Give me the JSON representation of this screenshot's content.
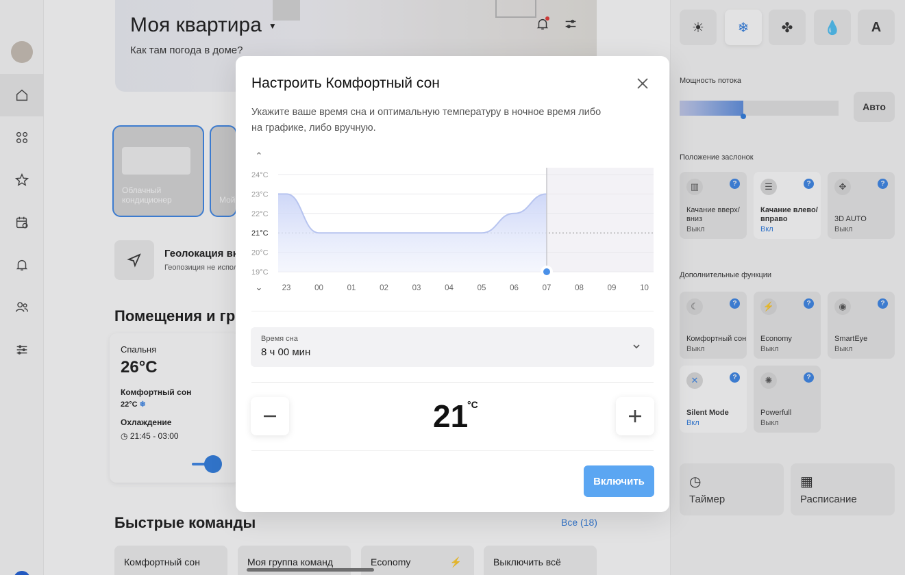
{
  "header": {
    "title": "Моя квартира",
    "subtitle": "Как там погода в доме?"
  },
  "devices": [
    {
      "label": "Облачный кондиционер"
    },
    {
      "label": "Мой"
    }
  ],
  "geo": {
    "title": "Геолокация вк",
    "subtitle": "Геопозиция не испол"
  },
  "rooms_title": "Помещения и гр",
  "room": {
    "name": "Спальня",
    "temp": "26°C",
    "mode_label": "Комфортный сон",
    "mode_temp": "22°C",
    "cooling": "Охлаждение",
    "schedule": "21:45 - 03:00"
  },
  "quick": {
    "title": "Быстрые команды",
    "all": "Все (18)",
    "items": [
      "Комфортный сон",
      "Моя группа команд",
      "Economy",
      "Выключить всё"
    ]
  },
  "right_panel": {
    "modes": [
      "sun-icon",
      "snowflake-icon",
      "fan-icon",
      "drop-icon",
      "A"
    ],
    "flow_label": "Мощность потока",
    "flow_auto": "Авто",
    "flow_level": 0.4,
    "louver_label": "Положение заслонок",
    "louvers": [
      {
        "name": "Качание вверх/вниз",
        "state": "Выкл",
        "on": false
      },
      {
        "name": "Качание влево/вправо",
        "state": "Вкл",
        "on": true
      },
      {
        "name": "3D AUTO",
        "state": "Выкл",
        "on": false
      }
    ],
    "extra_label": "Дополнительные функции",
    "features": [
      {
        "name": "Комфортный сон",
        "state": "Выкл"
      },
      {
        "name": "Economy",
        "state": "Выкл"
      },
      {
        "name": "SmartEye",
        "state": "Выкл"
      },
      {
        "name": "Silent Mode",
        "state": "Вкл"
      },
      {
        "name": "Powerfull",
        "state": "Выкл"
      }
    ],
    "timer": "Таймер",
    "schedule": "Расписание"
  },
  "modal": {
    "title": "Настроить Комфортный сон",
    "description": "Укажите ваше время сна и оптимальную температуру в ночное время либо на графике, либо вручную.",
    "sleep_label": "Время сна",
    "sleep_value": "8 ч 00 мин",
    "temperature": "21",
    "unit": "°C",
    "enable": "Включить"
  },
  "chart_data": {
    "type": "area",
    "x": [
      "23",
      "00",
      "01",
      "02",
      "03",
      "04",
      "05",
      "06",
      "07",
      "08",
      "09",
      "10"
    ],
    "y_ticks": [
      "24°C",
      "23°C",
      "22°C",
      "21°C",
      "20°C",
      "19°C"
    ],
    "ylim": [
      19,
      24
    ],
    "series": [
      {
        "values": [
          23,
          21,
          21,
          21,
          21,
          21,
          21,
          22,
          23
        ]
      }
    ],
    "target": 21,
    "sleep_end": "07"
  }
}
